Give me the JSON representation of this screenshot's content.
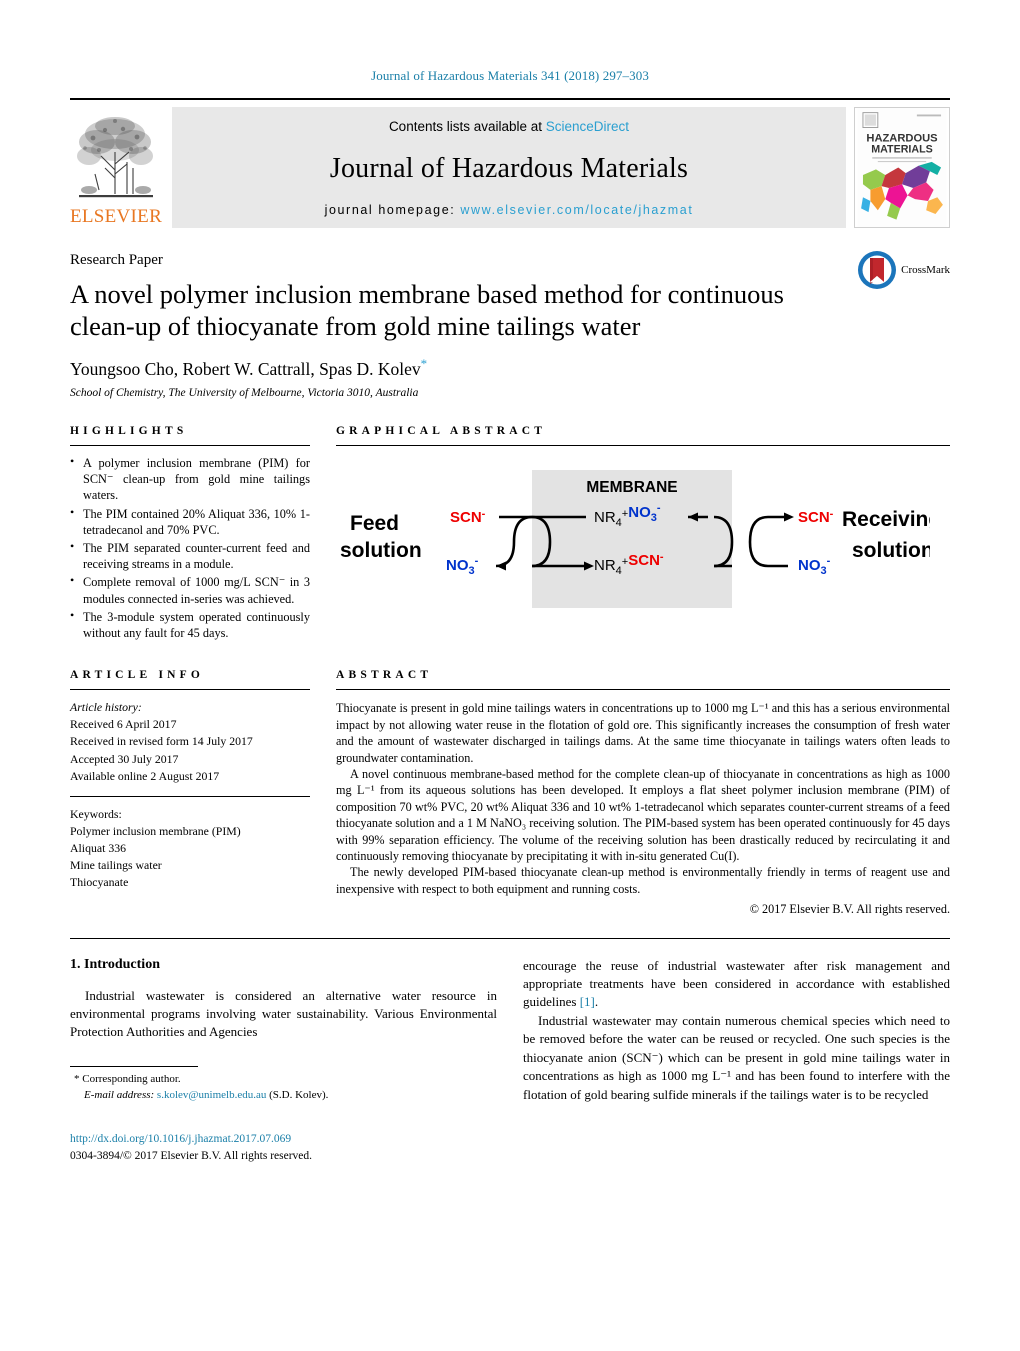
{
  "running_head": "Journal of Hazardous Materials 341 (2018) 297–303",
  "masthead": {
    "contents_prefix": "Contents lists available at ",
    "sciencedirect": "ScienceDirect",
    "journal_name": "Journal of Hazardous Materials",
    "homepage_prefix": "journal homepage: ",
    "homepage_url": "www.elsevier.com/locate/jhazmat",
    "publisher": "ELSEVIER",
    "cover_title_line1": "HAZARDOUS",
    "cover_title_line2": "MATERIALS"
  },
  "title_block": {
    "paper_type": "Research Paper",
    "title": "A novel polymer inclusion membrane based method for continuous clean-up of thiocyanate from gold mine tailings water",
    "authors": "Youngsoo Cho, Robert W. Cattrall, Spas D. Kolev",
    "corresponding_marker": "*",
    "affiliation": "School of Chemistry, The University of Melbourne, Victoria 3010, Australia",
    "crossmark_label": "CrossMark"
  },
  "highlights": {
    "heading": "HIGHLIGHTS",
    "items": [
      "A polymer inclusion membrane (PIM) for SCN⁻ clean-up from gold mine tailings waters.",
      "The PIM contained 20% Aliquat 336, 10% 1-tetradecanol and 70% PVC.",
      "The PIM separated counter-current feed and receiving streams in a module.",
      "Complete removal of 1000 mg/L SCN⁻ in 3 modules connected in-series was achieved.",
      "The 3-module system operated continuously without any fault for 45 days."
    ]
  },
  "graphical_abstract": {
    "heading": "GRAPHICAL ABSTRACT",
    "membrane_label": "MEMBRANE",
    "feed_line1": "Feed",
    "feed_line2": "solution",
    "receiving_line1": "Receiving",
    "receiving_line2": "solution",
    "feed_scn": "SCN",
    "feed_no3": "NO",
    "membrane_top_carrier": "NR",
    "membrane_top_ion": "NO",
    "membrane_bottom_carrier": "NR",
    "membrane_bottom_ion": "SCN",
    "recv_scn": "SCN",
    "recv_no3": "NO",
    "colors": {
      "scn": "#ee0000",
      "no3": "#0033cc",
      "membrane_bg": "#e3e3e3"
    }
  },
  "article_info": {
    "heading": "ARTICLE INFO",
    "history_label": "Article history:",
    "history": [
      "Received 6 April 2017",
      "Received in revised form 14 July 2017",
      "Accepted 30 July 2017",
      "Available online 2 August 2017"
    ],
    "keywords_label": "Keywords:",
    "keywords": [
      "Polymer inclusion membrane (PIM)",
      "Aliquat 336",
      "Mine tailings water",
      "Thiocyanate"
    ]
  },
  "abstract": {
    "heading": "ABSTRACT",
    "paragraphs": [
      "Thiocyanate is present in gold mine tailings waters in concentrations up to 1000 mg L⁻¹ and this has a serious environmental impact by not allowing water reuse in the flotation of gold ore. This significantly increases the consumption of fresh water and the amount of wastewater discharged in tailings dams. At the same time thiocyanate in tailings waters often leads to groundwater contamination.",
      "A novel continuous membrane-based method for the complete clean-up of thiocyanate in concentrations as high as 1000 mg L⁻¹ from its aqueous solutions has been developed. It employs a flat sheet polymer inclusion membrane (PIM) of composition 70 wt% PVC, 20 wt% Aliquat 336 and 10 wt% 1-tetradecanol which separates counter-current streams of a feed thiocyanate solution and a 1 M NaNO₃ receiving solution. The PIM-based system has been operated continuously for 45 days with 99% separation efficiency. The volume of the receiving solution has been drastically reduced by recirculating it and continuously removing thiocyanate by precipitating it with in-situ generated Cu(I).",
      "The newly developed PIM-based thiocyanate clean-up method is environmentally friendly in terms of reagent use and inexpensive with respect to both equipment and running costs."
    ],
    "copyright": "© 2017 Elsevier B.V. All rights reserved."
  },
  "body": {
    "section_number_title": "1. Introduction",
    "left_paragraph": "Industrial wastewater is considered an alternative water resource in environmental programs involving water sustainability. Various Environmental Protection Authorities and Agencies",
    "right_paragraph_1_a": "encourage the reuse of industrial wastewater after risk management and appropriate treatments have been considered in accordance with established guidelines ",
    "right_paragraph_1_ref": "[1]",
    "right_paragraph_1_b": ".",
    "right_paragraph_2": "Industrial wastewater may contain numerous chemical species which need to be removed before the water can be reused or recycled. One such species is the thiocyanate anion (SCN⁻) which can be present in gold mine tailings water in concentrations as high as 1000 mg L⁻¹ and has been found to interfere with the flotation of gold bearing sulfide minerals if the tailings water is to be recycled"
  },
  "footer": {
    "corresponding_marker": "*",
    "corresponding_label": "Corresponding author.",
    "email_label": "E-mail address:",
    "email": "s.kolev@unimelb.edu.au",
    "email_suffix": "(S.D. Kolev).",
    "doi": "http://dx.doi.org/10.1016/j.jhazmat.2017.07.069",
    "issn_line": "0304-3894/© 2017 Elsevier B.V. All rights reserved."
  }
}
